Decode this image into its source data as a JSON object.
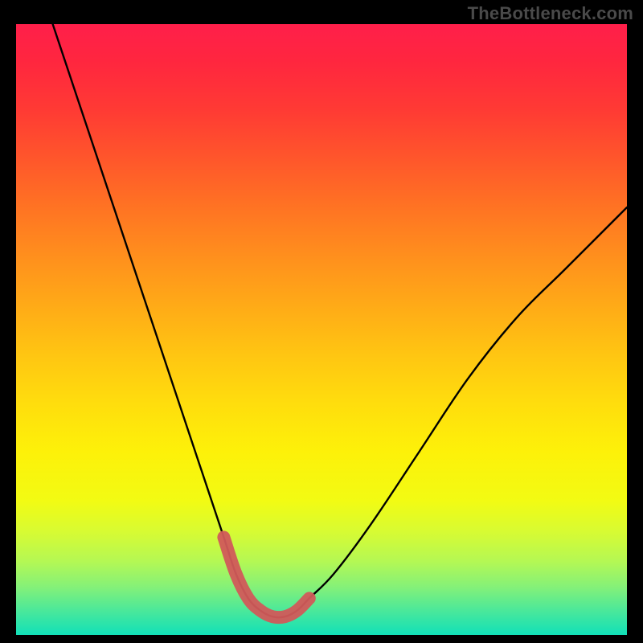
{
  "watermark": "TheBottleneck.com",
  "chart_data": {
    "type": "line",
    "title": "",
    "xlabel": "",
    "ylabel": "",
    "xlim": [
      0,
      100
    ],
    "ylim": [
      0,
      100
    ],
    "series": [
      {
        "name": "bottleneck-curve",
        "x": [
          6,
          10,
          14,
          18,
          22,
          26,
          30,
          34,
          36,
          38,
          40,
          42,
          44,
          46,
          48,
          52,
          58,
          66,
          74,
          82,
          90,
          100
        ],
        "values": [
          100,
          88,
          76,
          64,
          52,
          40,
          28,
          16,
          10,
          6,
          4,
          3,
          3,
          4,
          6,
          10,
          18,
          30,
          42,
          52,
          60,
          70
        ]
      },
      {
        "name": "highlight-segment",
        "x": [
          34,
          36,
          38,
          40,
          42,
          44,
          46,
          48
        ],
        "values": [
          16,
          10,
          6,
          4,
          3,
          3,
          4,
          6
        ]
      }
    ],
    "colors": {
      "curve": "#000000",
      "highlight": "#d15a5a",
      "gradient_top": "#ff1f4a",
      "gradient_bottom": "#11e0b8"
    }
  }
}
